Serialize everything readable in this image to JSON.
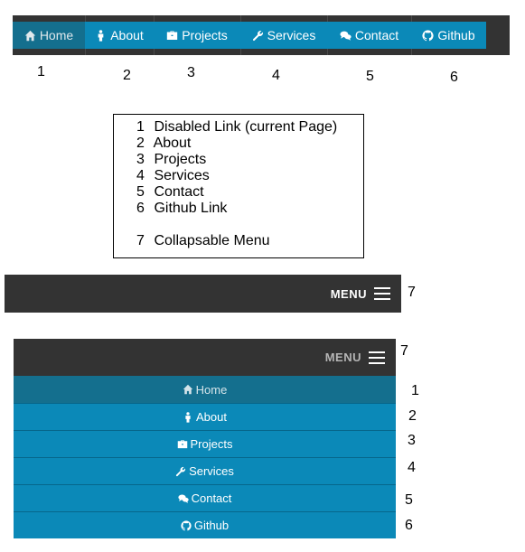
{
  "nav": {
    "items": [
      {
        "label": "Home",
        "icon": "home-icon"
      },
      {
        "label": "About",
        "icon": "person-icon"
      },
      {
        "label": "Projects",
        "icon": "briefcase-icon"
      },
      {
        "label": "Services",
        "icon": "wrench-icon"
      },
      {
        "label": "Contact",
        "icon": "chat-icon"
      },
      {
        "label": "Github",
        "icon": "github-icon"
      }
    ],
    "numbers": [
      "1",
      "2",
      "3",
      "4",
      "5",
      "6"
    ]
  },
  "legend": {
    "rows": [
      {
        "n": "1",
        "text": "Disabled Link (current Page)"
      },
      {
        "n": "2",
        "text": "About"
      },
      {
        "n": "3",
        "text": "Projects"
      },
      {
        "n": "4",
        "text": "Services"
      },
      {
        "n": "5",
        "text": "Contact"
      },
      {
        "n": "6",
        "text": "Github Link"
      }
    ],
    "last": {
      "n": "7",
      "text": "Collapsable Menu"
    }
  },
  "menu": {
    "label": "MENU",
    "number": "7"
  },
  "colors": {
    "bar": "#333333",
    "link": "#0b89b8",
    "current": "#146f8e"
  }
}
